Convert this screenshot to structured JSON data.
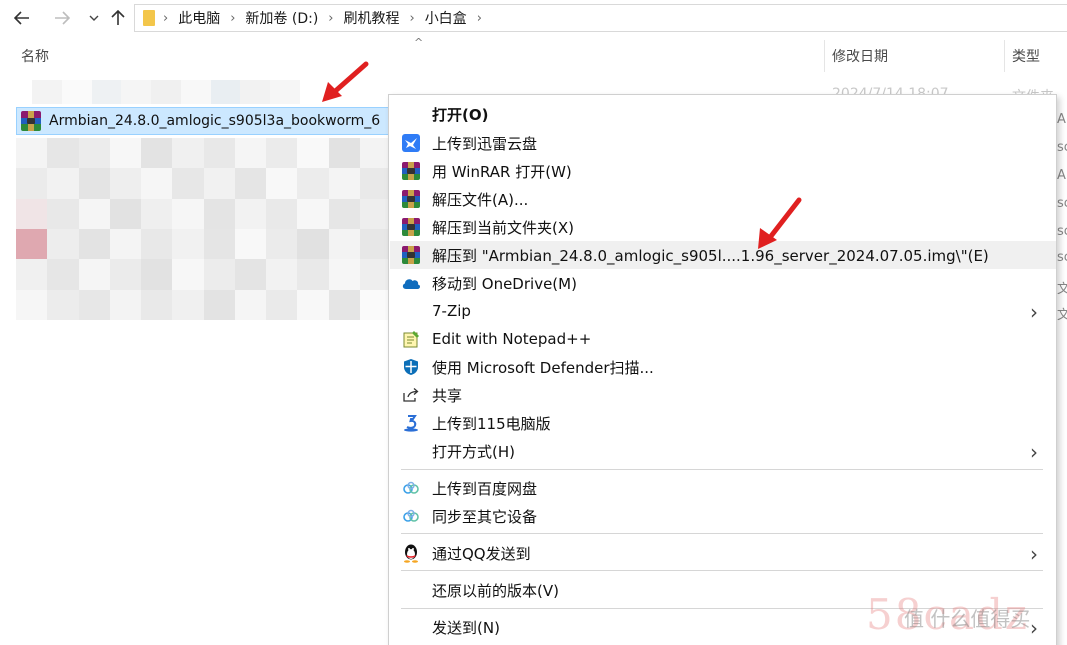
{
  "address_bar": {
    "breadcrumbs": [
      "此电脑",
      "新加卷 (D:)",
      "刷机教程",
      "小白盒"
    ]
  },
  "columns": {
    "name": "名称",
    "modified": "修改日期",
    "type": "类型"
  },
  "file_list": {
    "faded_row_date": "2024/7/14 18:07",
    "faded_row_type": "文件夹",
    "selected_file": "Armbian_24.8.0_amlogic_s905l3a_bookworm_6"
  },
  "right_column_fragments": [
    "AR",
    "sc",
    "AR",
    "sc",
    "sc",
    "sc",
    "文",
    "文"
  ],
  "context_menu": {
    "items": [
      {
        "label": "打开(O)",
        "icon": "none",
        "bold": true
      },
      {
        "label": "上传到迅雷云盘",
        "icon": "xunlei-bird-icon"
      },
      {
        "label": "用 WinRAR 打开(W)",
        "icon": "winrar-icon"
      },
      {
        "label": "解压文件(A)...",
        "icon": "winrar-icon"
      },
      {
        "label": "解压到当前文件夹(X)",
        "icon": "winrar-icon"
      },
      {
        "label": "解压到 \"Armbian_24.8.0_amlogic_s905l....1.96_server_2024.07.05.img\\\"(E)",
        "icon": "winrar-icon"
      },
      {
        "label": "移动到 OneDrive(M)",
        "icon": "onedrive-cloud-icon"
      },
      {
        "label": "7-Zip",
        "icon": "none",
        "submenu": true
      },
      {
        "label": "Edit with Notepad++",
        "icon": "notepad-plus-plus-icon"
      },
      {
        "label": "使用 Microsoft Defender扫描...",
        "icon": "defender-shield-icon"
      },
      {
        "label": "共享",
        "icon": "share-icon"
      },
      {
        "label": "上传到115电脑版",
        "icon": "115-icon"
      },
      {
        "label": "打开方式(H)",
        "icon": "none",
        "submenu": true
      },
      {
        "label": "上传到百度网盘",
        "icon": "baidu-netdisk-icon"
      },
      {
        "label": "同步至其它设备",
        "icon": "baidu-netdisk-icon"
      },
      {
        "label": "通过QQ发送到",
        "icon": "qq-penguin-icon",
        "submenu": true
      },
      {
        "label": "还原以前的版本(V)",
        "icon": "none"
      },
      {
        "label": "发送到(N)",
        "icon": "none",
        "submenu": true
      }
    ]
  },
  "watermark": {
    "text_main": "58cadz",
    "text_sub": "值 什么值得买"
  },
  "colors": {
    "selection_bg": "#cce8ff",
    "selection_border": "#99d1ff",
    "arrow_red": "#e02020",
    "menu_hover": "#f0f0f0"
  }
}
